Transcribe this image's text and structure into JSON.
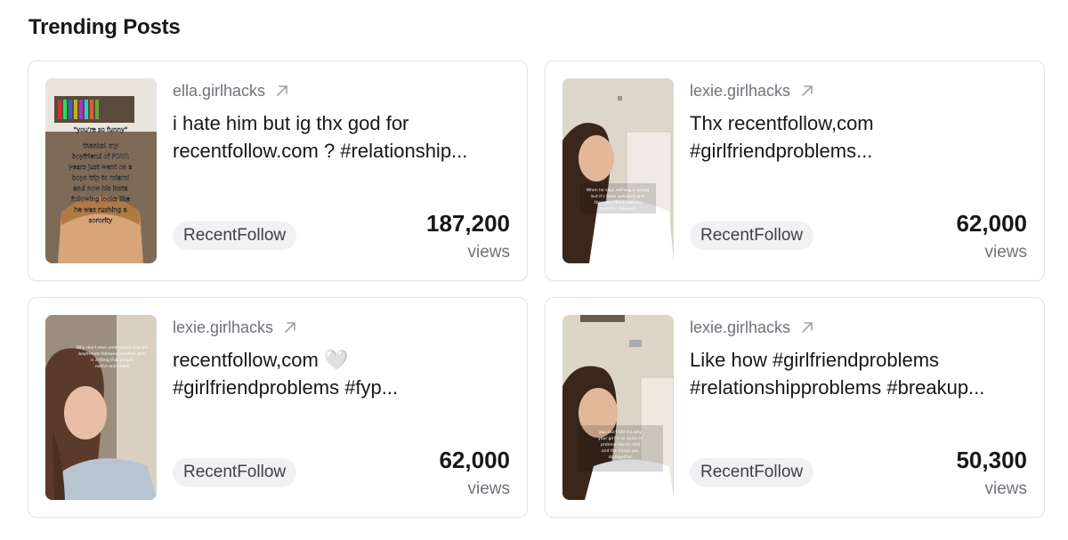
{
  "section": {
    "title": "Trending Posts"
  },
  "cards": [
    {
      "author": "ella.girlhacks",
      "caption_line1": "i hate him but ig thx god for",
      "caption_line2": "recentfollow.com ? #relationship...",
      "tag": "RecentFollow",
      "views": "187,200",
      "views_label": "views",
      "thumb_text": "\"you're so funny\" thanks! my boyfriend of FOUR years just went on a boys trip to miami and now his insta following looks like he was rushing a sorority 😂😂"
    },
    {
      "author": "lexie.girlhacks",
      "caption_line1": "Thx recentfollow,com",
      "caption_line2": "#girlfriendproblems...",
      "tag": "RecentFollow",
      "views": "62,000",
      "views_label": "views"
    },
    {
      "author": "lexie.girlhacks",
      "caption_line1": "recentfollow,com 🤍",
      "caption_line2": "#girlfriendproblems #fyp...",
      "tag": "RecentFollow",
      "views": "62,000",
      "views_label": "views"
    },
    {
      "author": "lexie.girlhacks",
      "caption_line1": "Like how #girlfriendproblems",
      "caption_line2": "#relationshipproblems #breakup...",
      "tag": "RecentFollow",
      "views": "50,300",
      "views_label": "views"
    }
  ],
  "icons": {
    "external_link": "arrow-up-right-icon"
  }
}
